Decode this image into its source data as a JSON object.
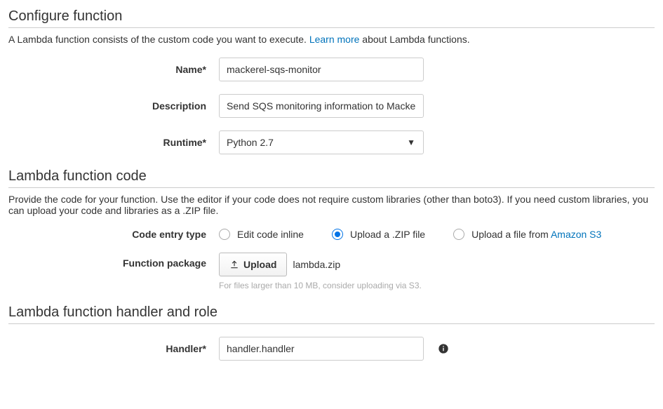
{
  "sections": {
    "configure": {
      "title": "Configure function",
      "desc_pre": "A Lambda function consists of the custom code you want to execute. ",
      "learn_more": "Learn more",
      "desc_post": " about Lambda functions."
    },
    "code": {
      "title": "Lambda function code",
      "desc": "Provide the code for your function. Use the editor if your code does not require custom libraries (other than boto3). If you need custom libraries, you can upload your code and libraries as a .ZIP file."
    },
    "handler": {
      "title": "Lambda function handler and role"
    }
  },
  "fields": {
    "name": {
      "label": "Name*",
      "value": "mackerel-sqs-monitor"
    },
    "description": {
      "label": "Description",
      "value": "Send SQS monitoring information to Mackerel"
    },
    "runtime": {
      "label": "Runtime*",
      "value": "Python 2.7"
    },
    "code_entry": {
      "label": "Code entry type",
      "options": {
        "inline": "Edit code inline",
        "zip": "Upload a .ZIP file",
        "s3_pre": "Upload a file from ",
        "s3_link": "Amazon S3"
      }
    },
    "package": {
      "label": "Function package",
      "button": "Upload",
      "filename": "lambda.zip",
      "hint": "For files larger than 10 MB, consider uploading via S3."
    },
    "handler": {
      "label": "Handler*",
      "value": "handler.handler"
    }
  }
}
